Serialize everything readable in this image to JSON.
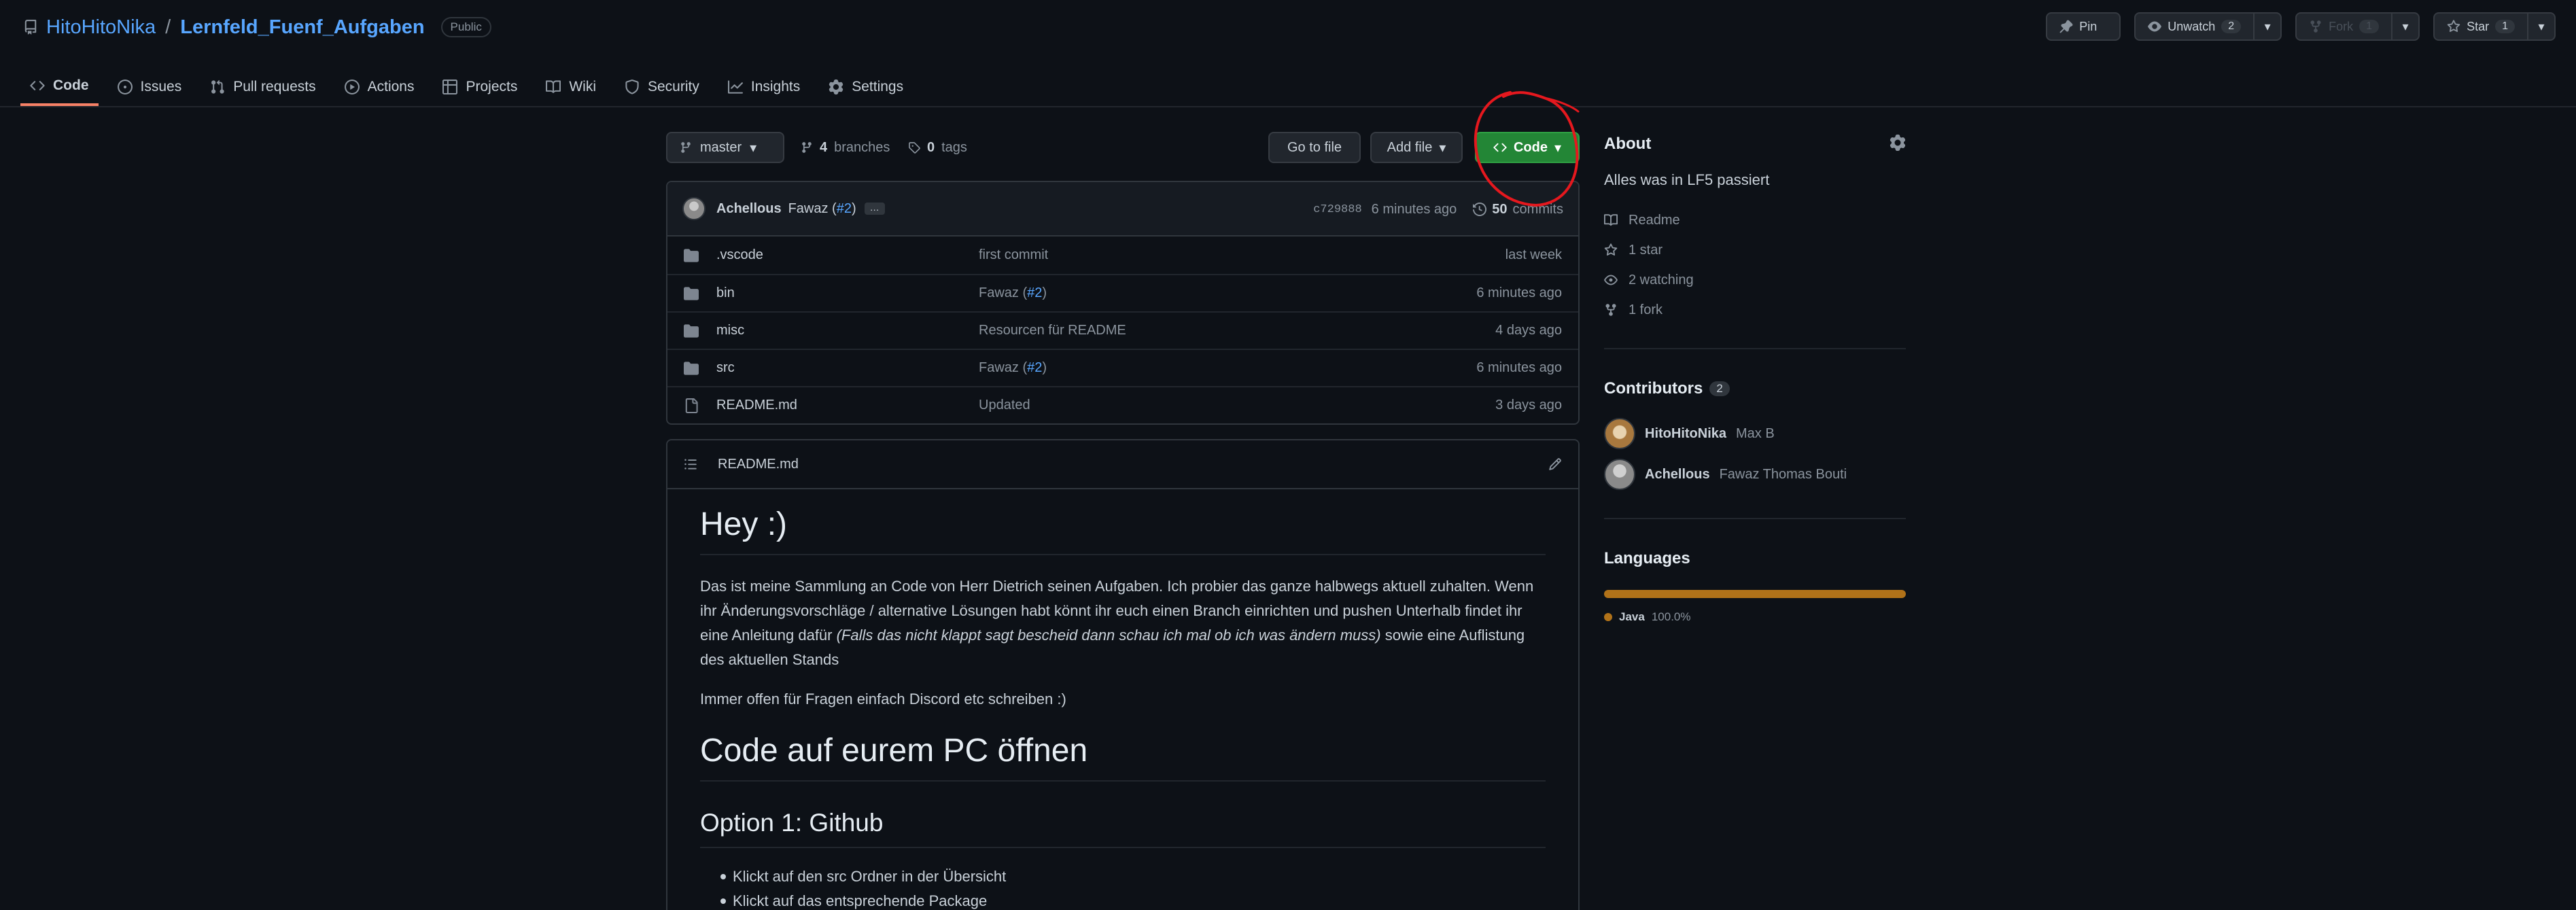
{
  "repo": {
    "owner": "HitoHitoNika",
    "separator": "/",
    "name": "Lernfeld_Fuenf_Aufgaben",
    "visibility": "Public"
  },
  "actions": {
    "pin": "Pin",
    "unwatch": "Unwatch",
    "unwatch_count": "2",
    "fork": "Fork",
    "fork_count": "1",
    "star": "Star",
    "star_count": "1"
  },
  "tabs": [
    {
      "label": "Code",
      "icon": "code-icon"
    },
    {
      "label": "Issues",
      "icon": "issue-icon"
    },
    {
      "label": "Pull requests",
      "icon": "pull-request-icon"
    },
    {
      "label": "Actions",
      "icon": "play-icon"
    },
    {
      "label": "Projects",
      "icon": "table-icon"
    },
    {
      "label": "Wiki",
      "icon": "book-icon"
    },
    {
      "label": "Security",
      "icon": "shield-icon"
    },
    {
      "label": "Insights",
      "icon": "graph-icon"
    },
    {
      "label": "Settings",
      "icon": "gear-icon"
    }
  ],
  "file_nav": {
    "branch": "master",
    "branches_count": "4",
    "branches_label": "branches",
    "tags_count": "0",
    "tags_label": "tags",
    "go_to_file": "Go to file",
    "add_file": "Add file",
    "code": "Code"
  },
  "commit": {
    "author": "Achellous",
    "message_prefix": "Fawaz (",
    "pr_link": "#2",
    "message_suffix": ")",
    "ellipsis": "…",
    "sha": "c729888",
    "time": "6 minutes ago",
    "commits_count": "50",
    "commits_label": "commits"
  },
  "files": [
    {
      "type": "folder",
      "name": ".vscode",
      "msg": "first commit",
      "link": "",
      "msg_suffix": "",
      "date": "last week"
    },
    {
      "type": "folder",
      "name": "bin",
      "msg": "Fawaz (",
      "link": "#2",
      "msg_suffix": ")",
      "date": "6 minutes ago"
    },
    {
      "type": "folder",
      "name": "misc",
      "msg": "Resourcen für README",
      "link": "",
      "msg_suffix": "",
      "date": "4 days ago"
    },
    {
      "type": "folder",
      "name": "src",
      "msg": "Fawaz (",
      "link": "#2",
      "msg_suffix": ")",
      "date": "6 minutes ago"
    },
    {
      "type": "file",
      "name": "README.md",
      "msg": "Updated",
      "link": "",
      "msg_suffix": "",
      "date": "3 days ago"
    }
  ],
  "readme": {
    "title": "README.md",
    "h1": "Hey :)",
    "p1_start": "Das ist meine Sammlung an Code von Herr Dietrich seinen Aufgaben. Ich probier das ganze halbwegs aktuell zuhalten. Wenn ihr Änderungsvorschläge / alternative Lösungen habt könnt ihr euch einen Branch einrichten und pushen Unterhalb findet ihr eine Anleitung dafür ",
    "p1_em": "(Falls das nicht klappt sagt bescheid dann schau ich mal ob ich was ändern muss)",
    "p1_end": " sowie eine Auflistung des aktuellen Stands",
    "p2": "Immer offen für Fragen einfach Discord etc schreiben :)",
    "h1b": "Code auf eurem PC öffnen",
    "h2": "Option 1: Github",
    "li1": "Klickt auf den src Ordner in der Übersicht",
    "li2": "Klickt auf das entsprechende Package"
  },
  "about": {
    "title": "About",
    "description": "Alles was in LF5 passiert",
    "readme": "Readme",
    "stars": "1 star",
    "watching": "2 watching",
    "forks": "1 fork"
  },
  "contributors": {
    "title": "Contributors",
    "count": "2",
    "list": [
      {
        "login": "HitoHitoNika",
        "name": "Max B"
      },
      {
        "login": "Achellous",
        "name": "Fawaz Thomas Bouti"
      }
    ]
  },
  "languages": {
    "title": "Languages",
    "items": [
      {
        "name": "Java",
        "percent": "100.0%",
        "color": "#b07219"
      }
    ]
  },
  "colors": {
    "background": "#0d1117",
    "link": "#58a6ff",
    "code_button": "#238636",
    "active_tab": "#f78166",
    "annotation": "#e5181e"
  }
}
